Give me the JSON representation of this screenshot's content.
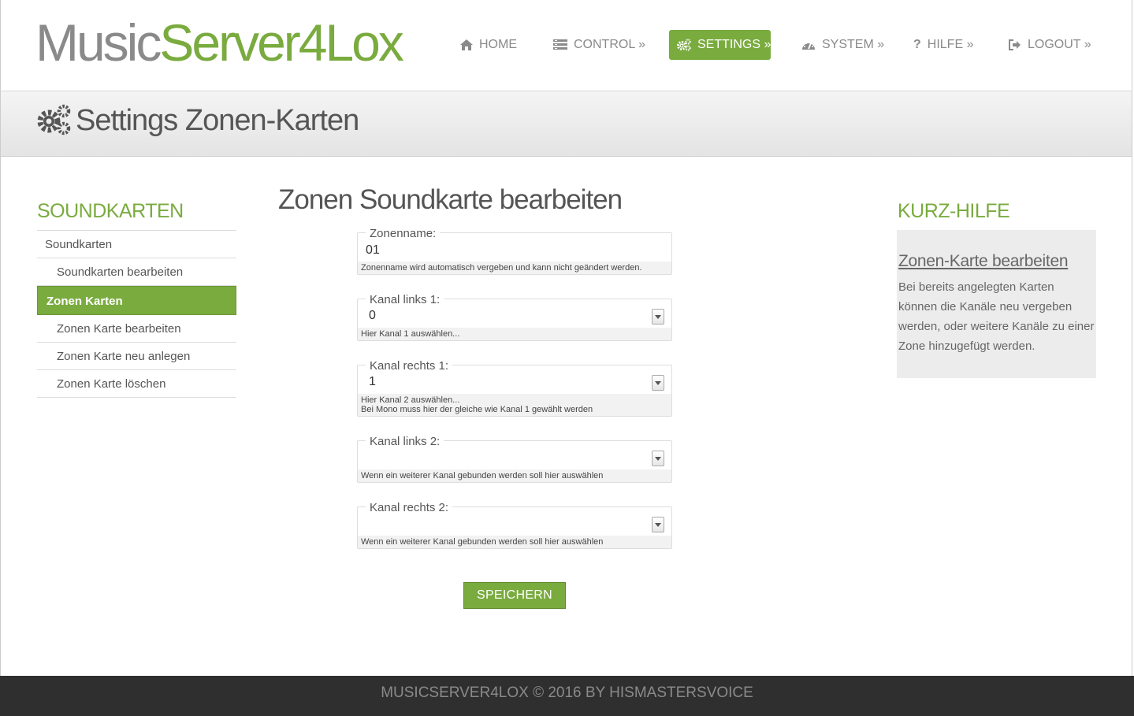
{
  "logo": {
    "part1": "Music",
    "part2": "Server4Lox"
  },
  "nav": [
    {
      "label": "HOME",
      "icon": "home-icon",
      "active": false
    },
    {
      "label": "CONTROL »",
      "icon": "list-icon",
      "active": false
    },
    {
      "label": "SETTINGS »",
      "icon": "gears-icon",
      "active": true
    },
    {
      "label": "SYSTEM »",
      "icon": "dashboard-icon",
      "active": false
    },
    {
      "label": "HILFE »",
      "icon": "question-icon",
      "active": false
    },
    {
      "label": "LOGOUT »",
      "icon": "logout-icon",
      "active": false
    }
  ],
  "page_title": "Settings Zonen-Karten",
  "sidebar": {
    "heading": "SOUNDKARTEN",
    "items": [
      {
        "label": "Soundkarten"
      },
      {
        "label": "Soundkarten bearbeiten"
      },
      {
        "label": "Zonen Karten"
      },
      {
        "label": "Zonen Karte bearbeiten"
      },
      {
        "label": "Zonen Karte neu anlegen"
      },
      {
        "label": "Zonen Karte löschen"
      }
    ]
  },
  "form": {
    "title": "Zonen Soundkarte bearbeiten",
    "zonenname": {
      "label": "Zonenname:",
      "value": "01",
      "hint": "Zonenname wird automatisch vergeben und kann nicht geändert werden."
    },
    "kanal_links_1": {
      "label": "Kanal links 1:",
      "value": "0",
      "hint": "Hier Kanal 1 auswählen..."
    },
    "kanal_rechts_1": {
      "label": "Kanal rechts 1:",
      "value": "1",
      "hint1": "Hier Kanal 2 auswählen...",
      "hint2": "Bei Mono muss hier der gleiche wie Kanal 1 gewählt werden"
    },
    "kanal_links_2": {
      "label": "Kanal links 2:",
      "value": "",
      "hint": "Wenn ein weiterer Kanal gebunden werden soll hier auswählen"
    },
    "kanal_rechts_2": {
      "label": "Kanal rechts 2:",
      "value": "",
      "hint": "Wenn ein weiterer Kanal gebunden werden soll hier auswählen"
    },
    "save_label": "SPEICHERN"
  },
  "help": {
    "heading": "KURZ-HILFE",
    "link": "Zonen-Karte bearbeiten",
    "text": "Bei bereits angelegten Karten können die Kanäle neu vergeben werden, oder weitere Kanäle zu einer Zone hinzugefügt werden."
  },
  "footer": "MUSICSERVER4LOX © 2016 BY HISMASTERSVOICE",
  "colors": {
    "accent": "#7aab3f",
    "footer_bg": "#2f2f2f",
    "text": "#555555"
  }
}
